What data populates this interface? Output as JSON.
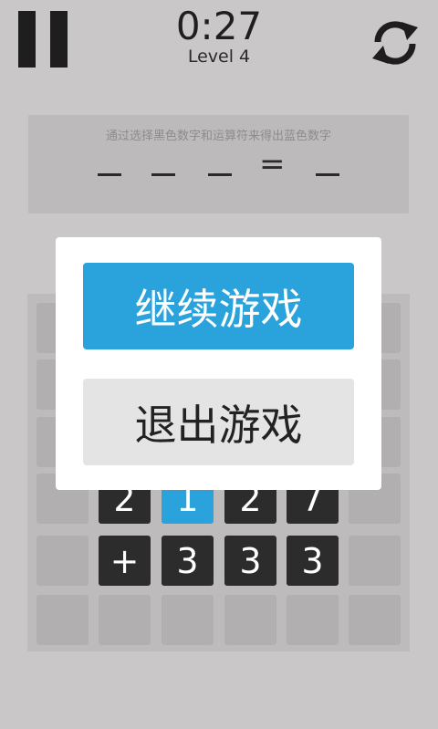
{
  "header": {
    "timer": "0:27",
    "level": "Level 4",
    "pause_icon": "pause-icon",
    "refresh_icon": "refresh-icon"
  },
  "puzzle": {
    "hint": "通过选择黑色数字和运算符来得出蓝色数字",
    "slots": [
      "_",
      "_",
      "_",
      "=",
      "_"
    ]
  },
  "board": {
    "row4": [
      "2",
      "1",
      "2",
      "7"
    ],
    "row5": [
      "+",
      "3",
      "3",
      "3"
    ]
  },
  "dialog": {
    "continue_label": "继续游戏",
    "quit_label": "退出游戏"
  },
  "colors": {
    "background": "#c9c7c8",
    "accent_blue": "#2aa2dc",
    "dark_tile": "#2c2c2c",
    "empty_tile": "#b1afaf"
  }
}
